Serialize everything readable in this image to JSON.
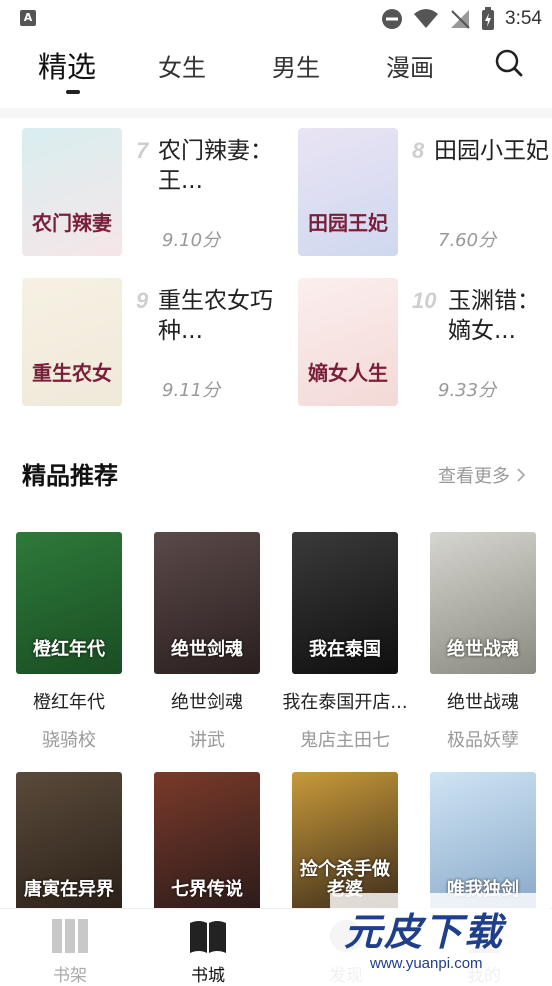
{
  "status_bar": {
    "time": "3:54",
    "app_badge": "A"
  },
  "top_tabs": [
    {
      "label": "精选",
      "active": true
    },
    {
      "label": "女生",
      "active": false
    },
    {
      "label": "男生",
      "active": false
    },
    {
      "label": "漫画",
      "active": false
    }
  ],
  "ranked_books": [
    {
      "rank": "7",
      "title": "农门辣妻：王...",
      "score": "9.10分",
      "cover_colors": [
        "#d9eef0",
        "#f5e6e8"
      ],
      "cover_text": "农门辣妻"
    },
    {
      "rank": "8",
      "title": "田园小王妃",
      "score": "7.60分",
      "cover_colors": [
        "#e9e4f4",
        "#cfd8ef"
      ],
      "cover_text": "田园王妃"
    },
    {
      "rank": "9",
      "title": "重生农女巧种...",
      "score": "9.11分",
      "cover_colors": [
        "#f6f1e2",
        "#efe9da"
      ],
      "cover_text": "重生农女"
    },
    {
      "rank": "10",
      "title": "玉渊错：嫡女...",
      "score": "9.33分",
      "cover_colors": [
        "#fbefee",
        "#f3d9d6"
      ],
      "cover_text": "嫡女人生"
    }
  ],
  "section": {
    "title": "精品推荐",
    "see_more": "查看更多"
  },
  "recommended": [
    {
      "title": "橙红年代",
      "author": "骁骑校",
      "cover_colors": [
        "#2d7a3a",
        "#1a4d23"
      ],
      "cover_text": "橙红年代"
    },
    {
      "title": "绝世剑魂",
      "author": "讲武",
      "cover_colors": [
        "#5a4a48",
        "#2a1f1f"
      ],
      "cover_text": "绝世剑魂"
    },
    {
      "title": "我在泰国开店...",
      "author": "鬼店主田七",
      "cover_colors": [
        "#3a3a3a",
        "#0f0f0f"
      ],
      "cover_text": "我在泰国"
    },
    {
      "title": "绝世战魂",
      "author": "极品妖孽",
      "cover_colors": [
        "#d6d6d0",
        "#8a8a80"
      ],
      "cover_text": "绝世战魂"
    },
    {
      "title": "",
      "author": "",
      "cover_colors": [
        "#5a4a3a",
        "#2a2018"
      ],
      "cover_text": "唐寅在异界"
    },
    {
      "title": "",
      "author": "",
      "cover_colors": [
        "#7a3a2a",
        "#2a1a1a"
      ],
      "cover_text": "七界传说"
    },
    {
      "title": "",
      "author": "",
      "cover_colors": [
        "#c89a3a",
        "#3a2a1a"
      ],
      "cover_text": "捡个杀手做老婆"
    },
    {
      "title": "",
      "author": "",
      "cover_colors": [
        "#cfe4f4",
        "#88a8c8"
      ],
      "cover_text": "唯我独剑"
    }
  ],
  "bottom_nav": [
    {
      "label": "书架",
      "active": false
    },
    {
      "label": "书城",
      "active": true
    },
    {
      "label": "发现",
      "active": false
    },
    {
      "label": "我的",
      "active": false
    }
  ],
  "watermark": {
    "logo": "元皮下载",
    "url": "www.yuanpi.com"
  },
  "colors": {
    "accent": "#222222",
    "muted": "#999999",
    "rank_number": "#cfcfcf",
    "watermark": "#1f3f8a"
  }
}
